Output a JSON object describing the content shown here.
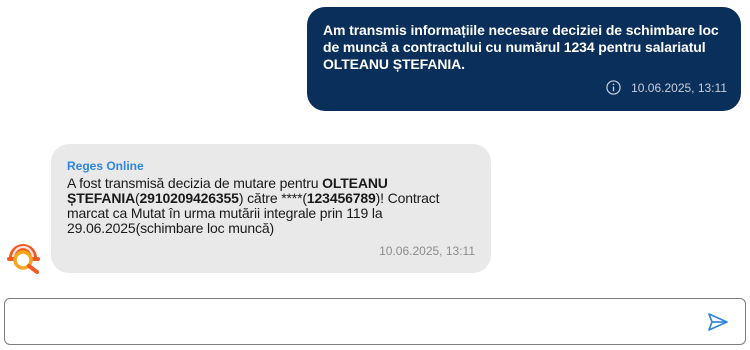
{
  "outgoing_message": {
    "text": "Am transmis informațiile necesare deciziei de schimbare loc de muncă a contractului cu numărul 1234 pentru salariatul OLTEANU  ȘTEFANIA.",
    "timestamp": "10.06.2025, 13:11",
    "info_icon": "info-icon"
  },
  "incoming_message": {
    "sender": "Reges Online",
    "part1": "A fost transmisă decizia de mutare pentru ",
    "name": "OLTEANU ȘTEFANIA",
    "part2": "(",
    "cnp": "2910209426355",
    "part3": ") către ****(",
    "cui": "123456789",
    "part4": ")! Contract marcat ca Mutat în urma mutării integrale prin 119 la 29.06.2025(schimbare loc muncă)",
    "timestamp": "10.06.2025, 13:11"
  },
  "avatar_icon": "hardhat-magnifier-icon",
  "composer": {
    "placeholder": "",
    "value": "",
    "send_icon": "send-icon"
  },
  "colors": {
    "outgoing_bg": "#0b2f5b",
    "incoming_bg": "#e9e9e9",
    "sender_color": "#2f86e0",
    "accent_orange": "#f15a24"
  }
}
